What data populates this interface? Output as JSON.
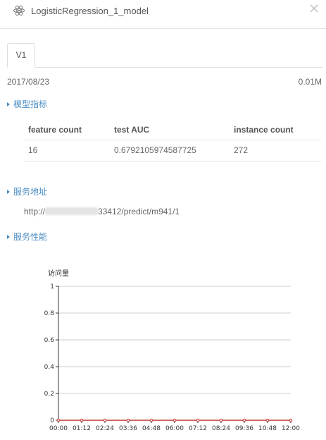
{
  "header": {
    "title": "LogisticRegression_1_model",
    "logo_icon": "atom-icon",
    "close_icon": "close-icon"
  },
  "tabs": [
    {
      "label": "V1"
    }
  ],
  "meta": {
    "date": "2017/08/23",
    "size": "0.01M"
  },
  "sections": {
    "metrics": "模型指标",
    "service_address": "服务地址",
    "service_performance": "服务性能"
  },
  "metrics_table": {
    "headers": [
      "feature count",
      "test AUC",
      "instance count"
    ],
    "rows": [
      [
        "16",
        "0.6792105974587725",
        "272"
      ]
    ]
  },
  "service": {
    "url_prefix": "http://",
    "url_suffix": "33412/predict/m941/1"
  },
  "chart_data": {
    "type": "line",
    "ylabel": "访问量",
    "x": [
      "00:00",
      "01:12",
      "02:24",
      "03:36",
      "04:48",
      "06:00",
      "07:12",
      "08:24",
      "09:36",
      "10:48",
      "12:00"
    ],
    "yticks": [
      "0",
      "0.2",
      "0.4",
      "0.6",
      "0.8",
      "1"
    ],
    "ylim": [
      0,
      1
    ],
    "series": [
      {
        "values": [
          0,
          0,
          0,
          0,
          0,
          0,
          0,
          0,
          0,
          0,
          0
        ]
      }
    ],
    "colors": {
      "line": "#c23531",
      "marker_fill": "#ffffff"
    },
    "grid": true
  }
}
